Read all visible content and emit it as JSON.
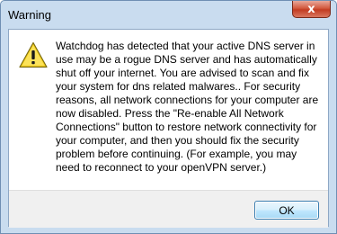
{
  "dialog": {
    "title": "Warning",
    "close_glyph": "x",
    "icon": "warning-icon",
    "message": "Watchdog has detected that your active DNS server in use may be a rogue DNS server and has automatically shut off your internet. You are advised to scan and fix your system for dns related malwares.. For security reasons, all network connections for your computer are now disabled. Press the \"Re-enable All Network Connections\" button to restore network connectivity for your computer, and then you should fix the security problem before continuing. (For example, you may need to reconnect to your openVPN server.)",
    "ok_label": "OK"
  },
  "colors": {
    "frame": "#c9dcef",
    "warning_yellow": "#f7d21e",
    "button_border": "#3c7fb1"
  }
}
